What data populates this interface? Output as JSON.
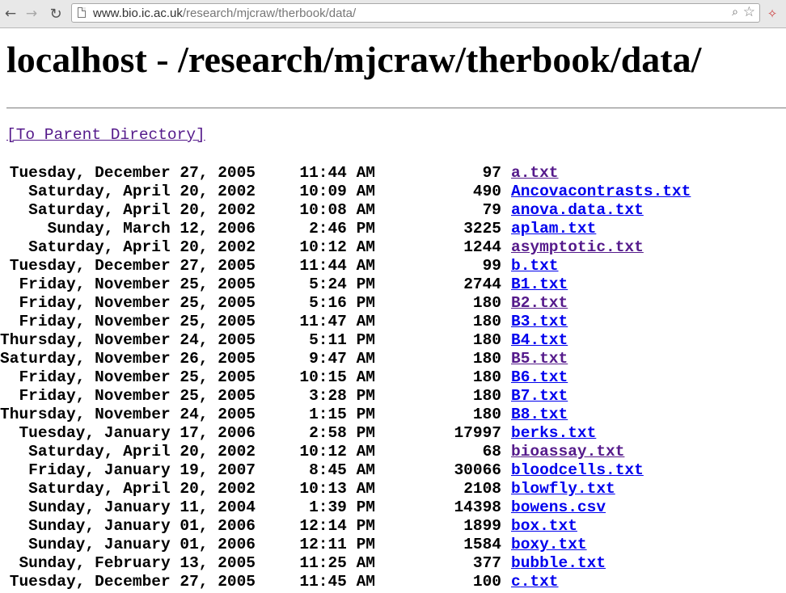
{
  "browser": {
    "url_host": "www.bio.ic.ac.uk",
    "url_path": "/research/mjcraw/therbook/data/"
  },
  "page": {
    "title": "localhost - /research/mjcraw/therbook/data/",
    "parent_link": "[To Parent Directory]"
  },
  "files": [
    {
      "date": "Tuesday, December 27, 2005",
      "time": "11:44 AM",
      "size": "97",
      "name": "a.txt",
      "visited": true
    },
    {
      "date": "Saturday, April 20, 2002",
      "time": "10:09 AM",
      "size": "490",
      "name": "Ancovacontrasts.txt",
      "visited": false
    },
    {
      "date": "Saturday, April 20, 2002",
      "time": "10:08 AM",
      "size": "79",
      "name": "anova.data.txt",
      "visited": false
    },
    {
      "date": "Sunday, March 12, 2006",
      "time": "2:46 PM",
      "size": "3225",
      "name": "aplam.txt",
      "visited": false
    },
    {
      "date": "Saturday, April 20, 2002",
      "time": "10:12 AM",
      "size": "1244",
      "name": "asymptotic.txt",
      "visited": true
    },
    {
      "date": "Tuesday, December 27, 2005",
      "time": "11:44 AM",
      "size": "99",
      "name": "b.txt",
      "visited": false
    },
    {
      "date": "Friday, November 25, 2005",
      "time": "5:24 PM",
      "size": "2744",
      "name": "B1.txt",
      "visited": false
    },
    {
      "date": "Friday, November 25, 2005",
      "time": "5:16 PM",
      "size": "180",
      "name": "B2.txt",
      "visited": true
    },
    {
      "date": "Friday, November 25, 2005",
      "time": "11:47 AM",
      "size": "180",
      "name": "B3.txt",
      "visited": false
    },
    {
      "date": "Thursday, November 24, 2005",
      "time": "5:11 PM",
      "size": "180",
      "name": "B4.txt",
      "visited": false
    },
    {
      "date": "Saturday, November 26, 2005",
      "time": "9:47 AM",
      "size": "180",
      "name": "B5.txt",
      "visited": true
    },
    {
      "date": "Friday, November 25, 2005",
      "time": "10:15 AM",
      "size": "180",
      "name": "B6.txt",
      "visited": false
    },
    {
      "date": "Friday, November 25, 2005",
      "time": "3:28 PM",
      "size": "180",
      "name": "B7.txt",
      "visited": false
    },
    {
      "date": "Thursday, November 24, 2005",
      "time": "1:15 PM",
      "size": "180",
      "name": "B8.txt",
      "visited": false
    },
    {
      "date": "Tuesday, January 17, 2006",
      "time": "2:58 PM",
      "size": "17997",
      "name": "berks.txt",
      "visited": false
    },
    {
      "date": "Saturday, April 20, 2002",
      "time": "10:12 AM",
      "size": "68",
      "name": "bioassay.txt",
      "visited": true
    },
    {
      "date": "Friday, January 19, 2007",
      "time": "8:45 AM",
      "size": "30066",
      "name": "bloodcells.txt",
      "visited": false
    },
    {
      "date": "Saturday, April 20, 2002",
      "time": "10:13 AM",
      "size": "2108",
      "name": "blowfly.txt",
      "visited": false
    },
    {
      "date": "Sunday, January 11, 2004",
      "time": "1:39 PM",
      "size": "14398",
      "name": "bowens.csv",
      "visited": false
    },
    {
      "date": "Sunday, January 01, 2006",
      "time": "12:14 PM",
      "size": "1899",
      "name": "box.txt",
      "visited": false
    },
    {
      "date": "Sunday, January 01, 2006",
      "time": "12:11 PM",
      "size": "1584",
      "name": "boxy.txt",
      "visited": false
    },
    {
      "date": "Sunday, February 13, 2005",
      "time": "11:25 AM",
      "size": "377",
      "name": "bubble.txt",
      "visited": false
    },
    {
      "date": "Tuesday, December 27, 2005",
      "time": "11:45 AM",
      "size": "100",
      "name": "c.txt",
      "visited": false
    }
  ]
}
